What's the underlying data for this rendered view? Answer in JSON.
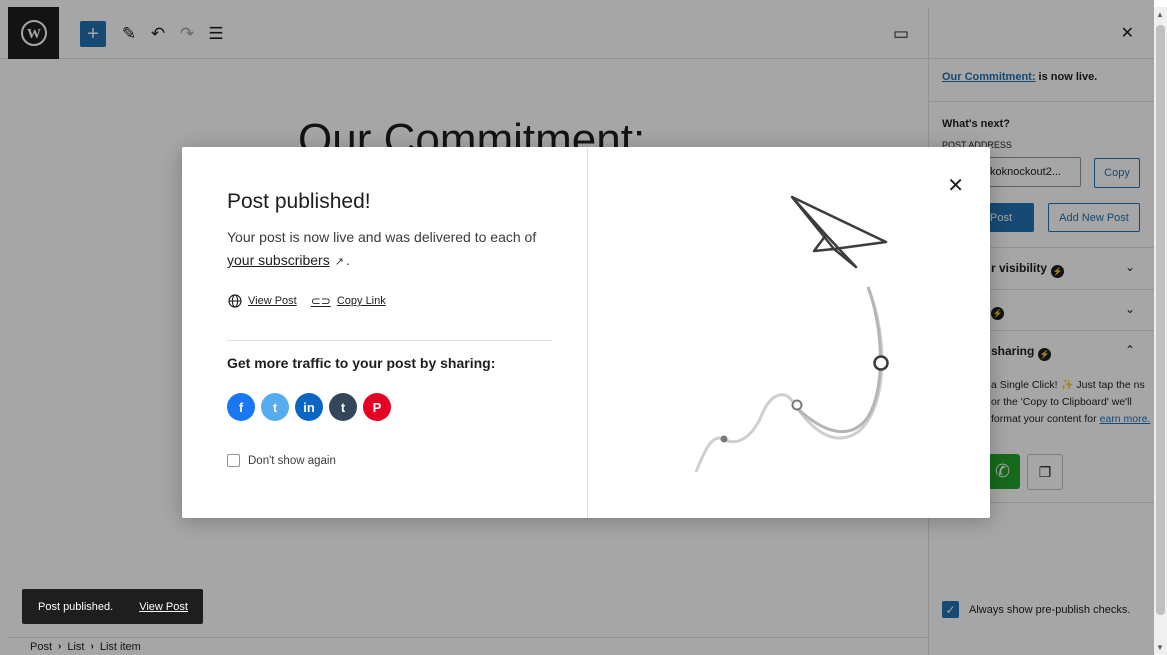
{
  "editor": {
    "post_title": "Our Commitment:"
  },
  "breadcrumbs": [
    "Post",
    "List",
    "List item"
  ],
  "sidebar": {
    "live_link": "Our Commitment:",
    "live_suffix": " is now live.",
    "whats_next": "What's next?",
    "post_address_label": "Post address",
    "post_address_value": "/koknockout2...",
    "copy_label": "Copy",
    "view_post_label": "Post",
    "add_new_post_label": "Add New Post",
    "panel_visibility": "r visibility",
    "panel_two": "",
    "panel_sharing": "sharing",
    "sharing_desc": "a Single Click! ✨ Just tap the ns or the 'Copy to Clipboard' we'll format your content for ",
    "learn_more": "earn more.",
    "always_show": "Always show pre-publish checks."
  },
  "snackbar": {
    "text": "Post published.",
    "link": "View Post"
  },
  "modal": {
    "title": "Post published!",
    "desc_prefix": "Your post is now live and was delivered to each of ",
    "subscribers_link": "your subscribers",
    "desc_suffix": ".",
    "view_post": "View Post",
    "copy_link": "Copy Link",
    "share_heading": "Get more traffic to your post by sharing:",
    "share_buttons": [
      {
        "name": "facebook",
        "glyph": "f",
        "color": "#1877f2"
      },
      {
        "name": "twitter",
        "glyph": "t",
        "color": "#55acee"
      },
      {
        "name": "linkedin",
        "glyph": "in",
        "color": "#0a66c2"
      },
      {
        "name": "tumblr",
        "glyph": "t",
        "color": "#35465c"
      },
      {
        "name": "pinterest",
        "glyph": "P",
        "color": "#e60023"
      }
    ],
    "dont_show": "Don't show again"
  },
  "colors": {
    "accent": "#2271b1",
    "dark": "#1e1e1e",
    "whatsapp": "#22a32a"
  }
}
